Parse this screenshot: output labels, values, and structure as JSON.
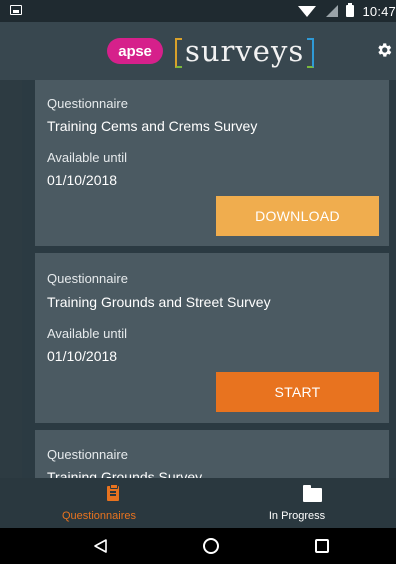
{
  "status_bar": {
    "time": "10:47"
  },
  "app_bar": {
    "logo_pill": "apse",
    "logo_word": "surveys",
    "settings_icon": "gear-icon"
  },
  "cards": [
    {
      "type_label": "Questionnaire",
      "title": "Training Cems and Crems Survey",
      "available_label": "Available until",
      "date": "01/10/2018",
      "action": "DOWNLOAD",
      "action_color": "#f0ad4e"
    },
    {
      "type_label": "Questionnaire",
      "title": "Training Grounds and Street Survey",
      "available_label": "Available until",
      "date": "01/10/2018",
      "action": "START",
      "action_color": "#e8731f"
    },
    {
      "type_label": "Questionnaire",
      "title": "Training Grounds Survey"
    }
  ],
  "bottom_nav": {
    "tabs": [
      {
        "label": "Questionnaires",
        "icon": "clipboard-icon",
        "active": true,
        "color": "#e8731f"
      },
      {
        "label": "In Progress",
        "icon": "folder-icon",
        "active": false,
        "color": "#ffffff"
      }
    ]
  },
  "system_nav": {
    "icons": [
      "back-icon",
      "home-icon",
      "recents-icon"
    ]
  },
  "colors": {
    "background": "#37474f",
    "card": "#4b5a62",
    "accent": "#e8731f",
    "download": "#f0ad4e",
    "brand_pink": "#d6208b"
  }
}
